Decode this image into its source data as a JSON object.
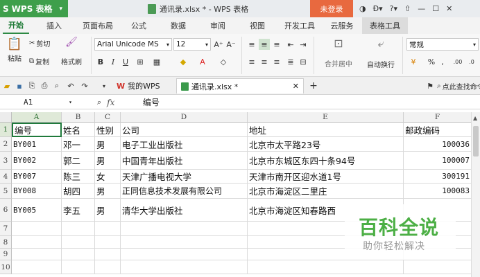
{
  "titlebar": {
    "app_name": "WPS 表格",
    "doc_title": "通讯录.xlsx * - WPS 表格",
    "login": "未登录",
    "icons": [
      "skin-icon",
      "b-icon",
      "help-icon",
      "upload-icon",
      "minimize-icon",
      "maximize-icon",
      "close-icon"
    ]
  },
  "ribbon": {
    "tabs": [
      {
        "label": "开始"
      },
      {
        "label": "插入"
      },
      {
        "label": "页面布局"
      },
      {
        "label": "公式"
      },
      {
        "label": "数据"
      },
      {
        "label": "审阅"
      },
      {
        "label": "视图"
      },
      {
        "label": "开发工具"
      },
      {
        "label": "云服务"
      },
      {
        "label": "表格工具"
      }
    ],
    "active_tab": "开始",
    "accent": "#2d8a44"
  },
  "toolbar": {
    "paste": "粘贴",
    "cut": "剪切",
    "copy": "复制",
    "format_painter": "格式刷",
    "font_name": "Arial Unicode MS",
    "font_size": "12",
    "merge_center": "合并居中",
    "wrap_text": "自动换行",
    "number_format": "常规"
  },
  "quickbar": {
    "tabs": [
      {
        "label": "我的WPS"
      },
      {
        "label": "通讯录.xlsx *"
      }
    ],
    "add": "+",
    "search": "点此查找命令"
  },
  "formula_bar": {
    "cell_ref": "A1",
    "fx": "fx",
    "content": "编号"
  },
  "grid": {
    "columns": [
      "A",
      "B",
      "C",
      "D",
      "E",
      "F"
    ],
    "rows": [
      {
        "num": "1",
        "cells": [
          "编号",
          "姓名",
          "性别",
          "公司",
          "地址",
          "邮政编码"
        ]
      },
      {
        "num": "2",
        "cells": [
          "BY001",
          "邓一",
          "男",
          "电子工业出版社",
          "北京市太平路23号",
          "100036"
        ]
      },
      {
        "num": "3",
        "cells": [
          "BY002",
          "郭二",
          "男",
          "中国青年出版社",
          "北京市东城区东四十条94号",
          "100007"
        ]
      },
      {
        "num": "4",
        "cells": [
          "BY007",
          "陈三",
          "女",
          "天津广播电视大学",
          "天津市南开区迎水道1号",
          "300191"
        ]
      },
      {
        "num": "5",
        "cells": [
          "BY008",
          "胡四",
          "男",
          "正同信息技术发展有限公司",
          "北京市海淀区二里庄",
          "100083"
        ]
      },
      {
        "num": "6",
        "cells": [
          "BY005",
          "李五",
          "男",
          "清华大学出版社",
          "北京市海淀区知春路西",
          ""
        ]
      },
      {
        "num": "7",
        "cells": [
          "",
          "",
          "",
          "",
          "",
          ""
        ]
      },
      {
        "num": "8",
        "cells": [
          "",
          "",
          "",
          "",
          "",
          ""
        ]
      },
      {
        "num": "9",
        "cells": [
          "",
          "",
          "",
          "",
          "",
          ""
        ]
      },
      {
        "num": "10",
        "cells": [
          "",
          "",
          "",
          "",
          "",
          ""
        ]
      }
    ]
  },
  "watermark": {
    "title": "百科全说",
    "subtitle": "助你轻松解决"
  }
}
